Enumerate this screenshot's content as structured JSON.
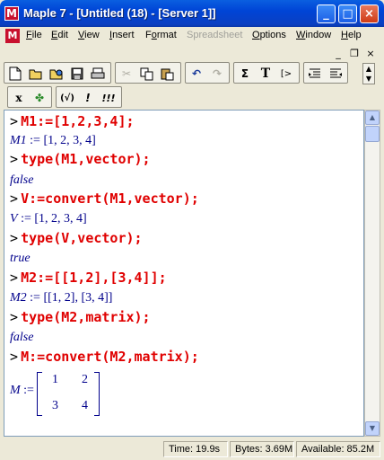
{
  "window": {
    "title": "Maple 7  - [Untitled (18) - [Server 1]]",
    "app_icon": "maple-leaf-icon",
    "controls": [
      "minimize-icon",
      "maximize-icon",
      "close-icon"
    ]
  },
  "menubar": {
    "items": [
      {
        "label": "File",
        "underline": "F"
      },
      {
        "label": "Edit",
        "underline": "E"
      },
      {
        "label": "View",
        "underline": "V"
      },
      {
        "label": "Insert",
        "underline": "I"
      },
      {
        "label": "Format",
        "underline": "o"
      },
      {
        "label": "Spreadsheet",
        "disabled": true
      },
      {
        "label": "Options",
        "underline": "O"
      },
      {
        "label": "Window",
        "underline": "W"
      },
      {
        "label": "Help",
        "underline": "H"
      }
    ]
  },
  "toolbar": {
    "sum_label": "Σ",
    "text_label": "T",
    "prompt_label": "[>",
    "x_label": "x",
    "eval_label": "(√)",
    "exec_label": "!",
    "exec_all_label": "!!!"
  },
  "worksheet": {
    "prompt": ">",
    "lines": [
      {
        "type": "input",
        "text": "M1:=[1,2,3,4];"
      },
      {
        "type": "output",
        "var": "M1",
        "value": ":= [1, 2, 3, 4]"
      },
      {
        "type": "input",
        "text": "type(M1,vector);"
      },
      {
        "type": "output",
        "var": "",
        "value": "false"
      },
      {
        "type": "input",
        "text": "V:=convert(M1,vector);"
      },
      {
        "type": "output",
        "var": "V",
        "value": ":= [1, 2, 3, 4]"
      },
      {
        "type": "input",
        "text": "type(V,vector);"
      },
      {
        "type": "output",
        "var": "",
        "value": "true"
      },
      {
        "type": "input",
        "text": "M2:=[[1,2],[3,4]];"
      },
      {
        "type": "output",
        "var": "M2",
        "value": ":= [[1, 2], [3, 4]]"
      },
      {
        "type": "input",
        "text": "type(M2,matrix);"
      },
      {
        "type": "output",
        "var": "",
        "value": "false"
      },
      {
        "type": "input",
        "text": "M:=convert(M2,matrix);"
      }
    ],
    "matrix_output": {
      "var": "M",
      "assign": ":=",
      "cells": [
        [
          "1",
          "2"
        ],
        [
          "3",
          "4"
        ]
      ]
    }
  },
  "statusbar": {
    "time": "Time:  19.9s",
    "bytes": "Bytes: 3.69M",
    "available": "Available: 85.2M"
  }
}
